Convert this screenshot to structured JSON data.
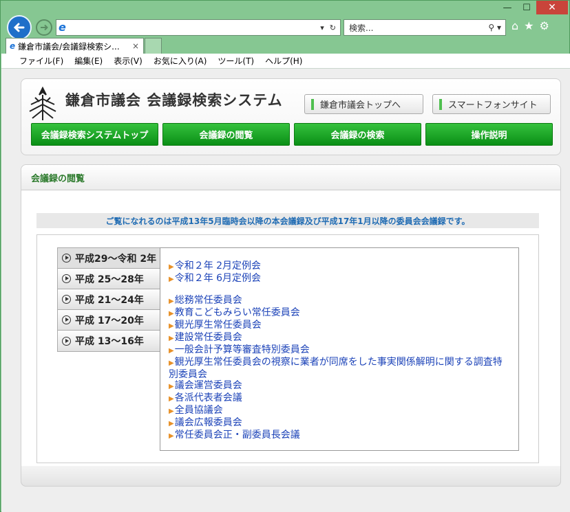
{
  "browser": {
    "search_placeholder": "検索...",
    "tab_title": "鎌倉市議会/会議録検索シ...",
    "tab_close": "×",
    "menu": [
      "ファイル(F)",
      "編集(E)",
      "表示(V)",
      "お気に入り(A)",
      "ツール(T)",
      "ヘルプ(H)"
    ]
  },
  "header": {
    "site_title": "鎌倉市議会 会議録検索システム",
    "link_top": "鎌倉市議会トップへ",
    "link_smartphone": "スマートフォンサイト"
  },
  "nav": [
    "会議録検索システムトップ",
    "会議録の閲覧",
    "会議録の検索",
    "操作説明"
  ],
  "panel": {
    "title": "会議録の閲覧",
    "notice": "ご覧になれるのは平成13年5月臨時会以降の本会議録及び平成17年1月以降の委員会会議録です。"
  },
  "years": [
    "平成29～令和 2年",
    "平成 25～28年",
    "平成 21～24年",
    "平成 17～20年",
    "平成 13～16年"
  ],
  "meetings": {
    "plenary": [
      "令和２年 2月定例会",
      "令和２年 6月定例会"
    ],
    "committees": [
      "総務常任委員会",
      "教育こどもみらい常任委員会",
      "観光厚生常任委員会",
      "建設常任委員会",
      "一般会計予算等審査特別委員会",
      "観光厚生常任委員会の視察に業者が同席をした事実関係解明に関する調査特別委員会",
      "議会運営委員会",
      "各派代表者会議",
      "全員協議会",
      "議会広報委員会",
      "常任委員会正・副委員長会議"
    ]
  },
  "colors": {
    "accent_green": "#0a8f16",
    "link_blue": "#1c43b8",
    "arrow_orange": "#e8922a",
    "window_frame": "#86c792"
  }
}
